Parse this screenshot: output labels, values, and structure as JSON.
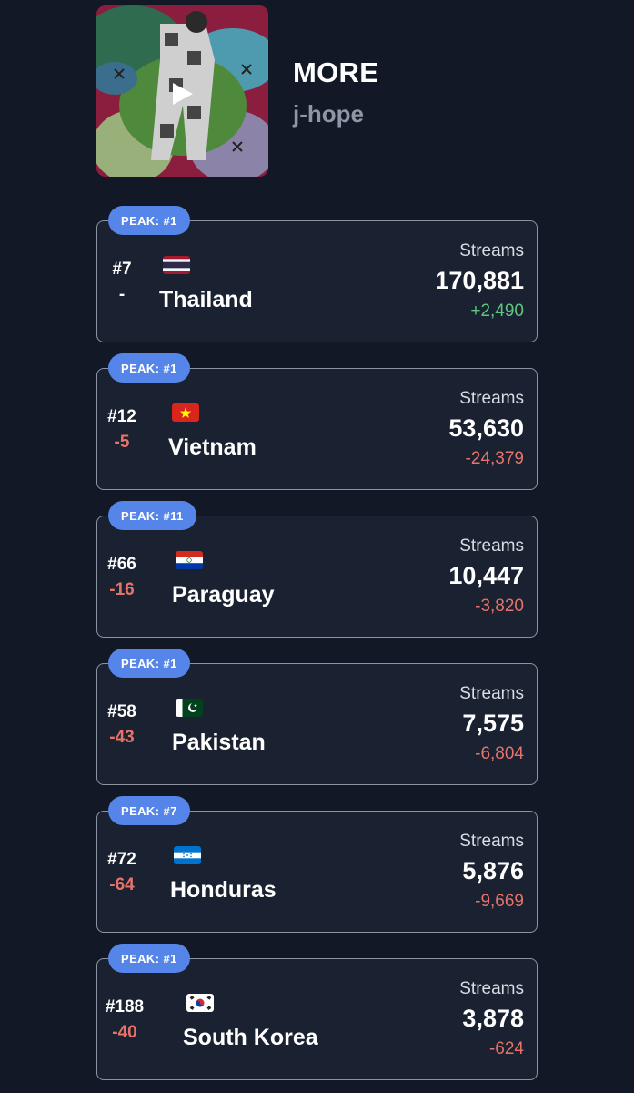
{
  "song": {
    "title": "MORE",
    "artist": "j-hope"
  },
  "colors": {
    "background": "#121826",
    "peak_badge": "#5585e8",
    "positive": "#5fc77e",
    "negative": "#e5736b"
  },
  "streams_label": "Streams",
  "rows": [
    {
      "peak": "PEAK: #1",
      "rank": "#7",
      "change": "-",
      "country": "Thailand",
      "flag_icon": "thailand-flag-icon",
      "streams": "170,881",
      "delta": "+2,490"
    },
    {
      "peak": "PEAK: #1",
      "rank": "#12",
      "change": "-5",
      "country": "Vietnam",
      "flag_icon": "vietnam-flag-icon",
      "streams": "53,630",
      "delta": "-24,379"
    },
    {
      "peak": "PEAK: #11",
      "rank": "#66",
      "change": "-16",
      "country": "Paraguay",
      "flag_icon": "paraguay-flag-icon",
      "streams": "10,447",
      "delta": "-3,820"
    },
    {
      "peak": "PEAK: #1",
      "rank": "#58",
      "change": "-43",
      "country": "Pakistan",
      "flag_icon": "pakistan-flag-icon",
      "streams": "7,575",
      "delta": "-6,804"
    },
    {
      "peak": "PEAK: #7",
      "rank": "#72",
      "change": "-64",
      "country": "Honduras",
      "flag_icon": "honduras-flag-icon",
      "streams": "5,876",
      "delta": "-9,669"
    },
    {
      "peak": "PEAK: #1",
      "rank": "#188",
      "change": "-40",
      "country": "South Korea",
      "flag_icon": "south-korea-flag-icon",
      "streams": "3,878",
      "delta": "-624"
    }
  ]
}
